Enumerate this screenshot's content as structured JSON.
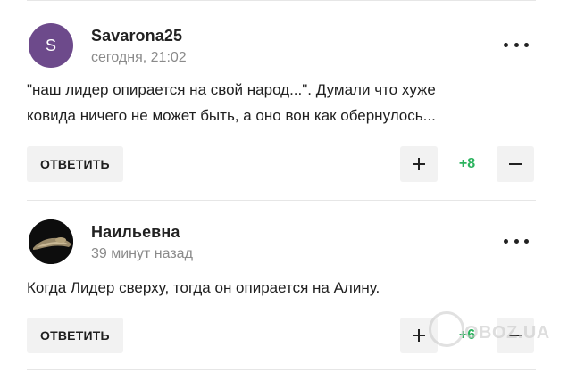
{
  "comments": [
    {
      "author": "Savarona25",
      "avatar_letter": "S",
      "avatar_color": "#6d4a8b",
      "timestamp": "сегодня, 21:02",
      "text_lines": [
        "\"наш лидер опирается на свой народ...\". Думали что хуже",
        "ковида ничего не может быть, а оно вон как обернулось..."
      ],
      "reply_label": "ОТВЕТИТЬ",
      "score": "+8"
    },
    {
      "author": "Наильевна",
      "avatar_icon": "user-photo-avatar",
      "timestamp": "39 минут назад",
      "text_lines": [
        "Когда Лидер сверху, тогда он опирается на Алину."
      ],
      "reply_label": "ОТВЕТИТЬ",
      "score": "+6"
    }
  ],
  "watermark": "OBOZ.UA",
  "colors": {
    "score_positive": "#2bb35e",
    "button_bg": "#f2f2f2",
    "timestamp": "#8a8a8a"
  }
}
